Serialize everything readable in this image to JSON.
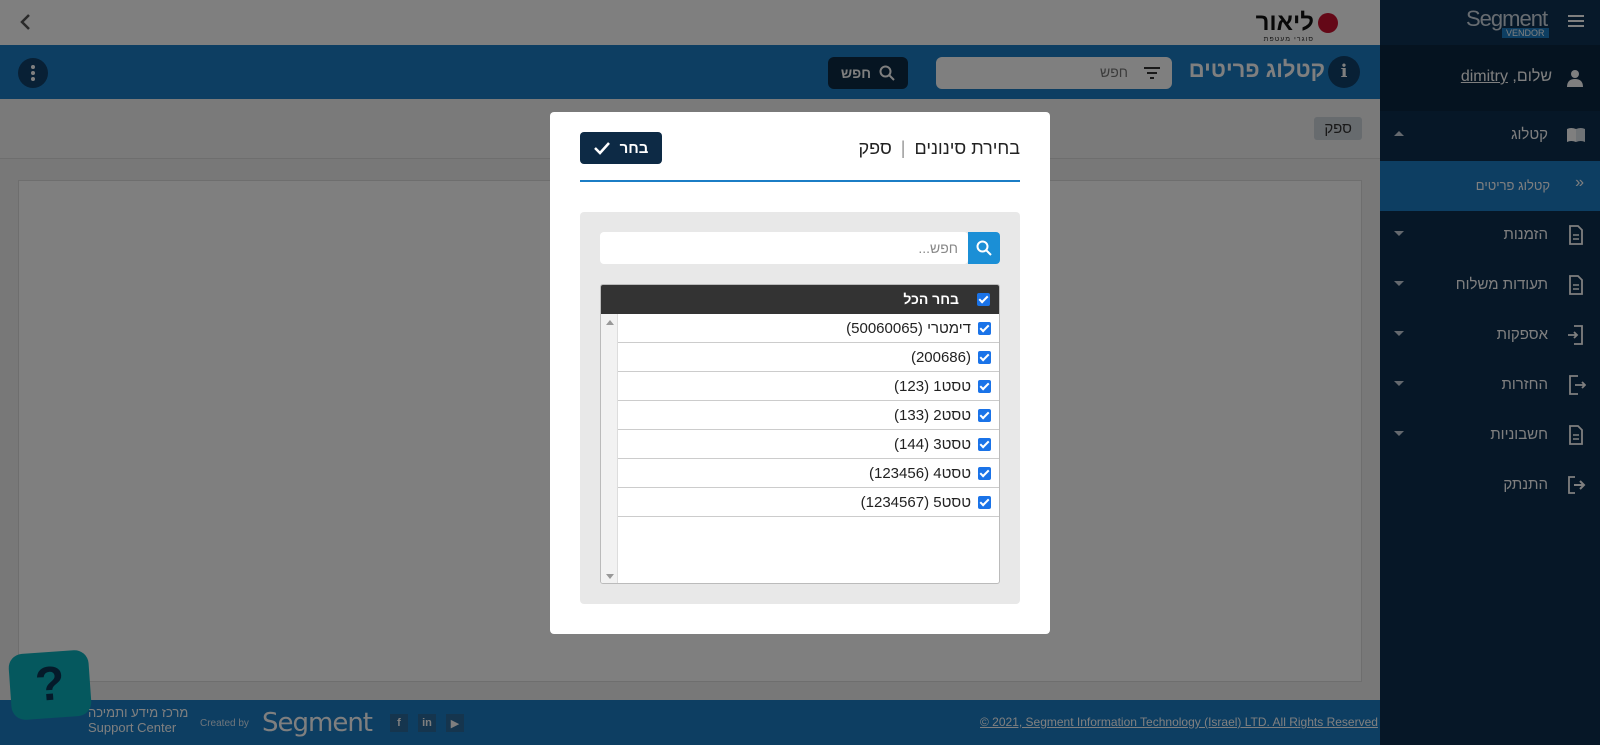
{
  "topbar": {
    "brand_name": "ליאור",
    "brand_tagline": "סוגרי מעטפת"
  },
  "header": {
    "title": "קטלוג פריטים",
    "search_placeholder": "חפש",
    "search_button": "חפש"
  },
  "filter_strip": {
    "chip": "ספק"
  },
  "sidebar": {
    "brand": "Segment",
    "vendor_tag": "VENDOR",
    "greeting_prefix": "שלום,",
    "username": "dimitry",
    "items": [
      {
        "label": "קטלוג",
        "icon": "book-icon"
      },
      {
        "label": "קטלוג פריטים",
        "icon": "double-chevron-icon"
      },
      {
        "label": "הזמנות",
        "icon": "document-icon"
      },
      {
        "label": "תעודות משלוח",
        "icon": "document-icon"
      },
      {
        "label": "אספקות",
        "icon": "import-icon"
      },
      {
        "label": "החזרות",
        "icon": "export-icon"
      },
      {
        "label": "חשבוניות",
        "icon": "document-icon"
      },
      {
        "label": "התנתק",
        "icon": "logout-icon"
      }
    ]
  },
  "modal": {
    "title": "בחירת סינונים",
    "title_separator": "|",
    "subtitle": "ספק",
    "choose_button": "בחר",
    "search_placeholder": "חפש...",
    "select_all_label": "בחר הכל",
    "options": [
      {
        "label": "דימטרי (50060065)",
        "checked": true
      },
      {
        "label": "(200686)",
        "checked": true
      },
      {
        "label": "טסט1 (123)",
        "checked": true
      },
      {
        "label": "טסט2 (133)",
        "checked": true
      },
      {
        "label": "טסט3 (144)",
        "checked": true
      },
      {
        "label": "טסט4 (123456)",
        "checked": true
      },
      {
        "label": "טסט5 (1234567)",
        "checked": true
      }
    ]
  },
  "footer": {
    "copyright": "© 2021, Segment Information Technology (Israel) LTD. All Rights Reserved",
    "created_by": "Created by",
    "created_brand": "Segment",
    "support_he": "מרכז מידע ותמיכה",
    "support_en": "Support Center",
    "social": [
      "f",
      "in",
      "▶"
    ]
  },
  "colors": {
    "primary_blue": "#1b7dc5",
    "navy": "#0d2a45",
    "sidebar_bg": "#0d2f4e",
    "checkbox": "#1a73e8"
  }
}
